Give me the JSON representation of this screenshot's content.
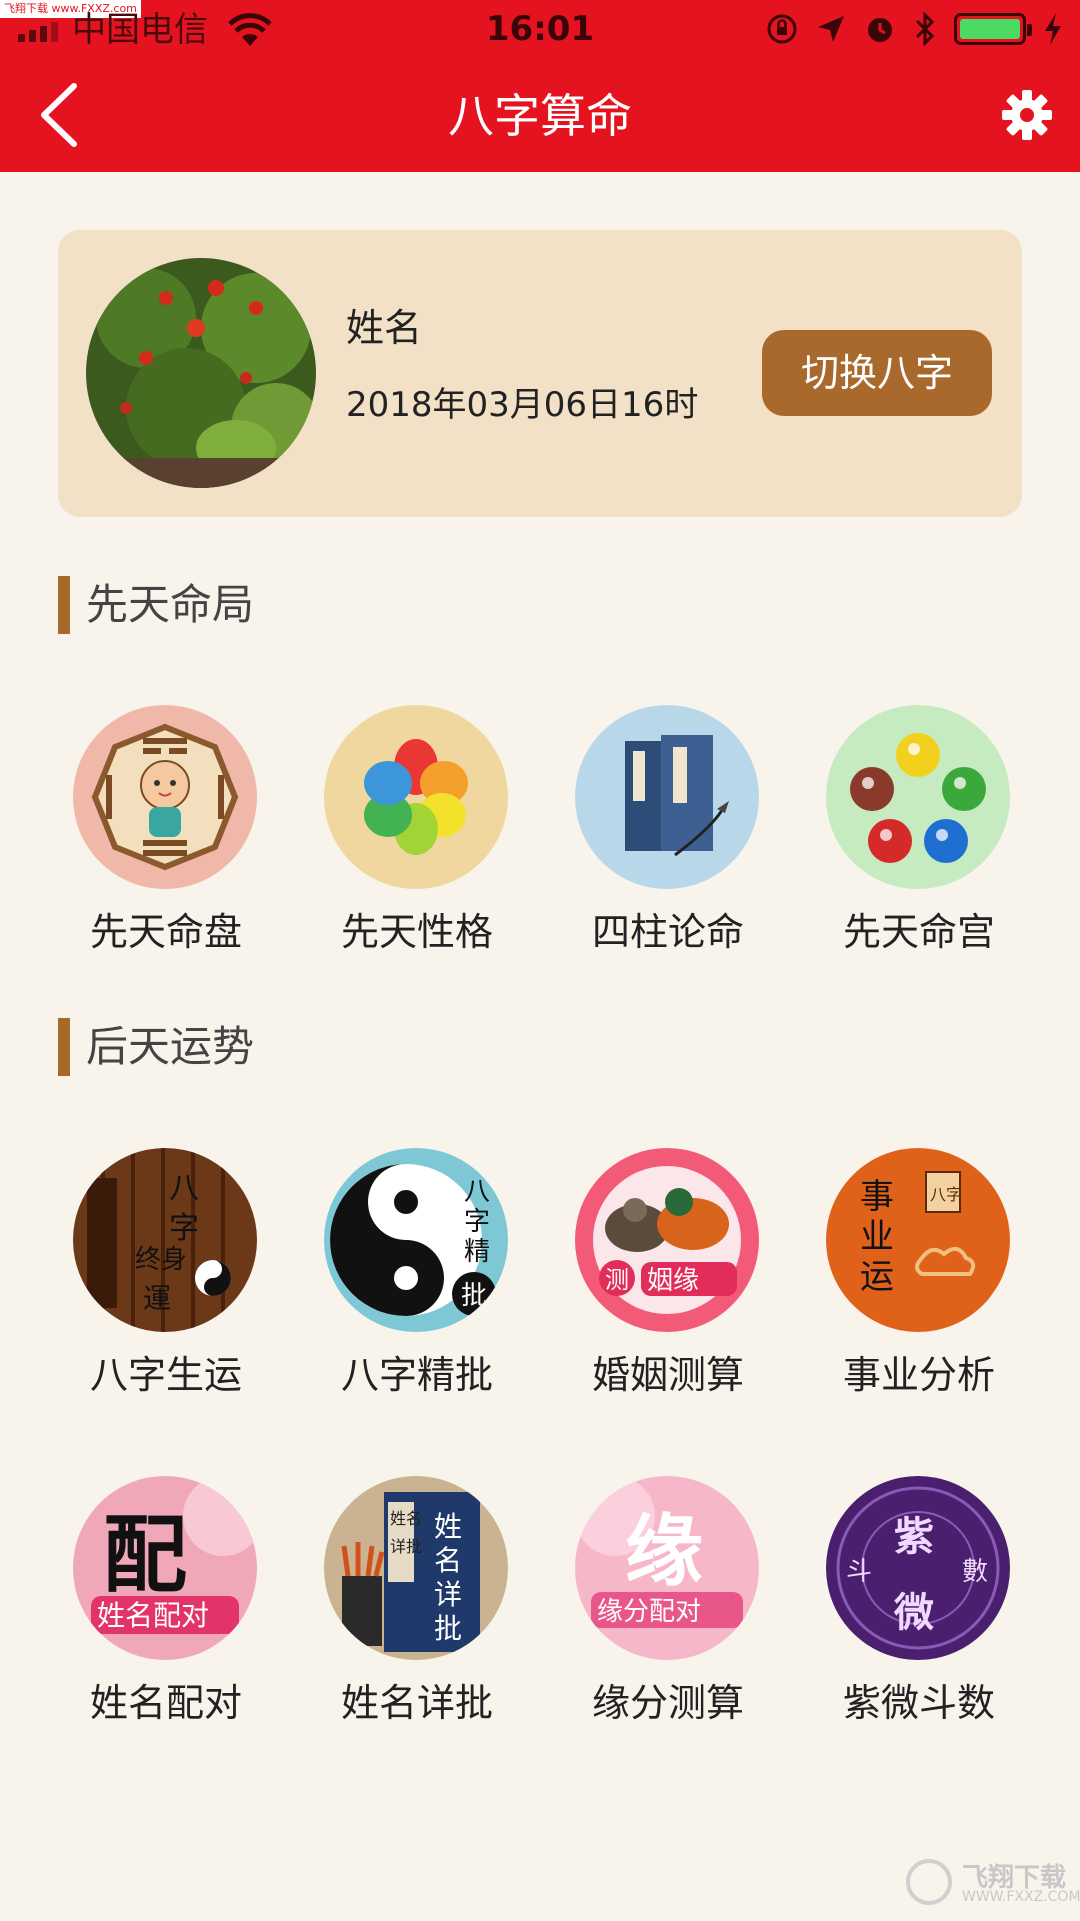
{
  "status_bar": {
    "watermark_tag": "飞翔下载 www.FXXZ.com",
    "carrier": "中国电信",
    "time": "16:01",
    "icons": [
      "wifi-icon",
      "lock-rotation-icon",
      "location-icon",
      "alarm-icon",
      "bluetooth-icon",
      "battery-icon",
      "charging-icon"
    ],
    "battery_level": 0.9
  },
  "nav": {
    "title": "八字算命",
    "back_icon": "chevron-left-icon",
    "settings_icon": "gear-icon",
    "bg_color": "#e5131f"
  },
  "profile": {
    "name_label": "姓名",
    "birth": "2018年03月06日16时",
    "switch_label": "切换八字",
    "accent": "#a9692c"
  },
  "section1": {
    "title": "先天命局",
    "items": [
      {
        "label": "先天命盘",
        "icon": "bagua-baby-icon"
      },
      {
        "label": "先天性格",
        "icon": "flower-petals-icon"
      },
      {
        "label": "四柱论命",
        "icon": "ancient-books-icon"
      },
      {
        "label": "先天命宫",
        "icon": "five-elements-icon"
      }
    ]
  },
  "section2": {
    "title": "后天运势",
    "items": [
      {
        "label": "八字生运",
        "icon": "bamboo-scroll-icon",
        "art_text": "八字终身运"
      },
      {
        "label": "八字精批",
        "icon": "yin-yang-icon",
        "art_text": "八字精批"
      },
      {
        "label": "婚姻测算",
        "icon": "mandarin-ducks-icon",
        "art_text": "测 姻缘"
      },
      {
        "label": "事业分析",
        "icon": "career-cloud-icon",
        "art_text": "事业运 八字"
      },
      {
        "label": "姓名配对",
        "icon": "name-match-icon",
        "art_text": "配 姓名配对"
      },
      {
        "label": "姓名详批",
        "icon": "name-book-icon",
        "art_text": "姓名详批"
      },
      {
        "label": "缘分测算",
        "icon": "fate-match-icon",
        "art_text": "缘 缘分配对"
      },
      {
        "label": "紫微斗数",
        "icon": "ziwei-chart-icon",
        "art_text": "紫微斗數"
      }
    ]
  },
  "watermark": {
    "main": "飞翔下载",
    "sub": "WWW.FXXZ.COM"
  }
}
